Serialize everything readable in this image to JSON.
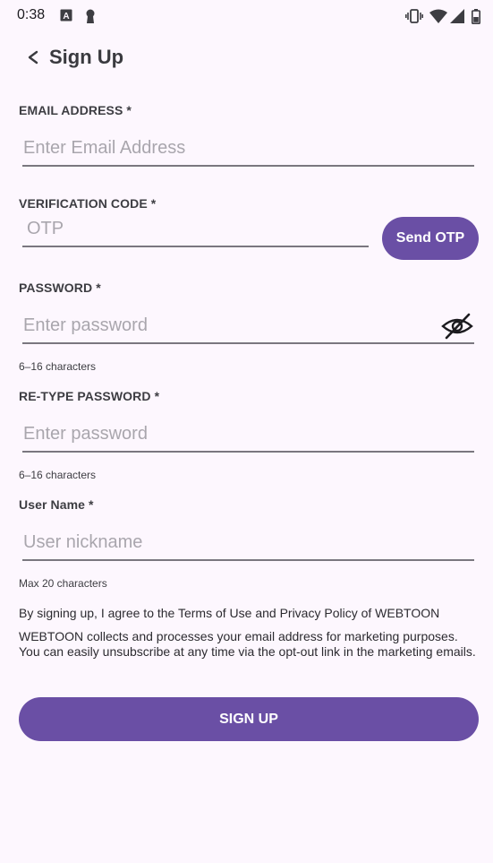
{
  "status_bar": {
    "time": "0:38",
    "icons": [
      "keyboard-a-icon",
      "keyhole-icon",
      "vibrate-icon",
      "wifi-icon",
      "signal-icon",
      "battery-icon"
    ]
  },
  "header": {
    "back_icon": "chevron-left-icon",
    "title": "Sign Up"
  },
  "form": {
    "email": {
      "label": "EMAIL ADDRESS *",
      "placeholder": "Enter Email Address",
      "value": ""
    },
    "verification": {
      "label": "VERIFICATION CODE *",
      "placeholder": "OTP",
      "value": "",
      "button_label": "Send OTP"
    },
    "password": {
      "label": "PASSWORD *",
      "placeholder": "Enter password",
      "value": "",
      "helper": "6–16 characters",
      "toggle_icon": "eye-off-icon"
    },
    "retype_password": {
      "label": "RE-TYPE PASSWORD *",
      "placeholder": "Enter password",
      "value": "",
      "helper": "6–16 characters"
    },
    "username": {
      "label": "User Name *",
      "placeholder": "User nickname",
      "value": "",
      "helper": "Max 20 characters"
    }
  },
  "consent": {
    "terms_text": "By signing up, I agree to the Terms of Use and Privacy Policy of WEBTOON",
    "marketing_text": "WEBTOON collects and processes your email address for marketing purposes. You can easily unsubscribe at any time via the opt-out link in the marketing emails."
  },
  "submit": {
    "label": "SIGN UP"
  },
  "colors": {
    "background": "#fdf7fe",
    "accent": "#6a4fa5",
    "underline": "#7a777f",
    "placeholder": "#a9a6ad"
  }
}
